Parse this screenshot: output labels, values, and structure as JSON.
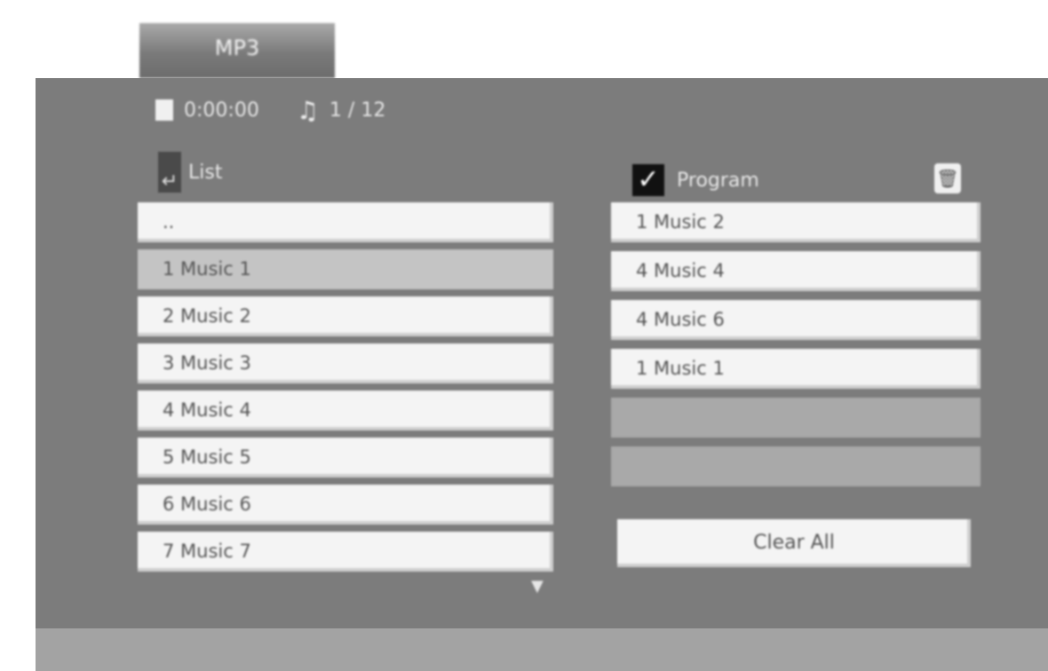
{
  "tab": {
    "label": "MP3"
  },
  "info": {
    "disc_time": "0:00:00",
    "track_count": "1 / 12"
  },
  "list_panel": {
    "title": "List",
    "items": [
      {
        "label": ".."
      },
      {
        "label": "1 Music 1"
      },
      {
        "label": "2 Music 2"
      },
      {
        "label": "3 Music 3"
      },
      {
        "label": "4 Music 4"
      },
      {
        "label": "5 Music 5"
      },
      {
        "label": "6 Music 6"
      },
      {
        "label": "7 Music 7"
      }
    ]
  },
  "program_panel": {
    "title": "Program",
    "items": [
      {
        "label": "1 Music 2"
      },
      {
        "label": "4 Music 4"
      },
      {
        "label": "4 Music 6"
      },
      {
        "label": "1 Music 1"
      }
    ],
    "clear_label": "Clear All"
  },
  "icons": {
    "disc": "disc-icon",
    "note": "music-note-icon",
    "list": "list-icon",
    "check": "checkbox-icon",
    "trash": "trash-icon",
    "scroll": "scroll-down-icon"
  }
}
